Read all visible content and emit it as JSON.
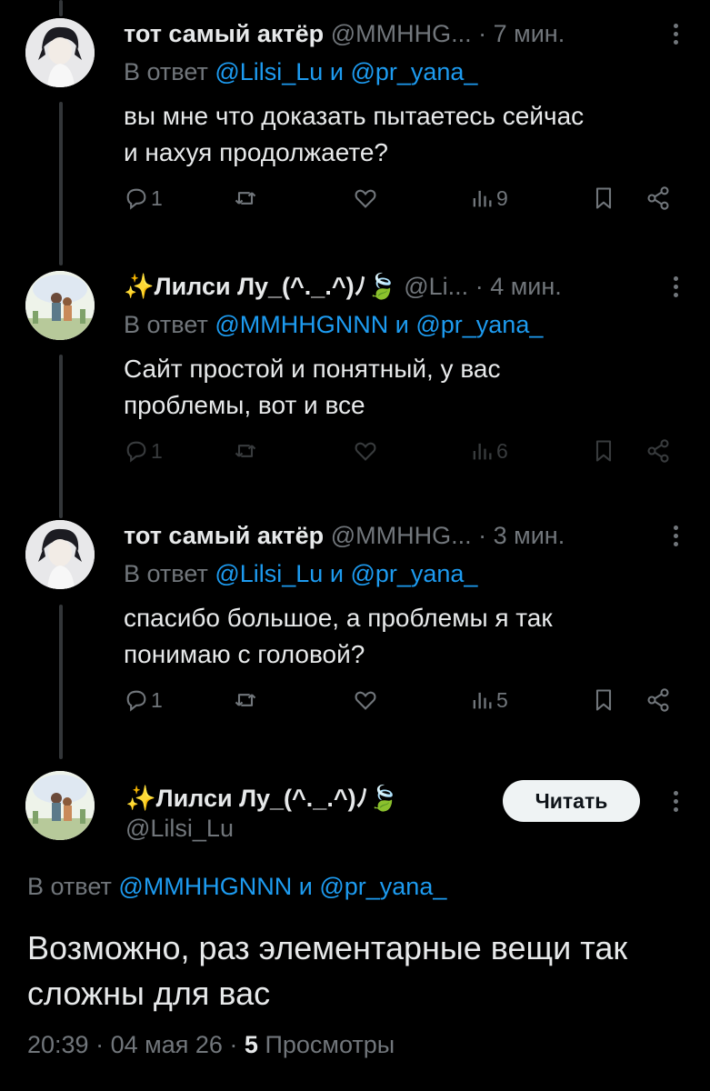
{
  "tweets": [
    {
      "name": "тот самый актёр",
      "handle": "@MMHHG...",
      "time": "7 мин.",
      "reply_prefix": "В ответ",
      "reply_to_1": "@Lilsi_Lu",
      "reply_and": "и",
      "reply_to_2": "@pr_yana_",
      "text": "вы мне что доказать пытаетесь сейчас\nи нахуя продолжаете?",
      "replies": "1",
      "views": "9"
    },
    {
      "name": "✨Лилси Лу_(^._.^)ﾉ🍃",
      "handle": "@Li...",
      "time": "4 мин.",
      "reply_prefix": "В ответ",
      "reply_to_1": "@MMHHGNNN",
      "reply_and": "и",
      "reply_to_2": "@pr_yana_",
      "text": "Сайт простой и понятный, у вас\nпроблемы, вот и все",
      "replies": "1",
      "views": "6"
    },
    {
      "name": "тот самый актёр",
      "handle": "@MMHHG...",
      "time": "3 мин.",
      "reply_prefix": "В ответ",
      "reply_to_1": "@Lilsi_Lu",
      "reply_and": "и",
      "reply_to_2": "@pr_yana_",
      "text": "спасибо большое, а проблемы я так\nпонимаю с головой?",
      "replies": "1",
      "views": "5"
    }
  ],
  "main": {
    "name": "✨Лилси Лу_(^._.^)ﾉ🍃",
    "handle": "@Lilsi_Lu",
    "follow_label": "Читать",
    "reply_prefix": "В ответ",
    "reply_to_1": "@MMHHGNNN",
    "reply_and": "и",
    "reply_to_2": "@pr_yana_",
    "text": "Возможно, раз элементарные вещи так сложны для вас",
    "time": "20:39",
    "date": "04 мая 26",
    "views_count": "5",
    "views_label": "Просмотры"
  },
  "colors": {
    "background": "#000000",
    "link": "#1d9bf0",
    "muted": "#71767b",
    "text": "#e7e9ea"
  },
  "icons": [
    "reply-icon",
    "retweet-icon",
    "like-icon",
    "views-icon",
    "bookmark-icon",
    "share-icon",
    "more-icon"
  ]
}
